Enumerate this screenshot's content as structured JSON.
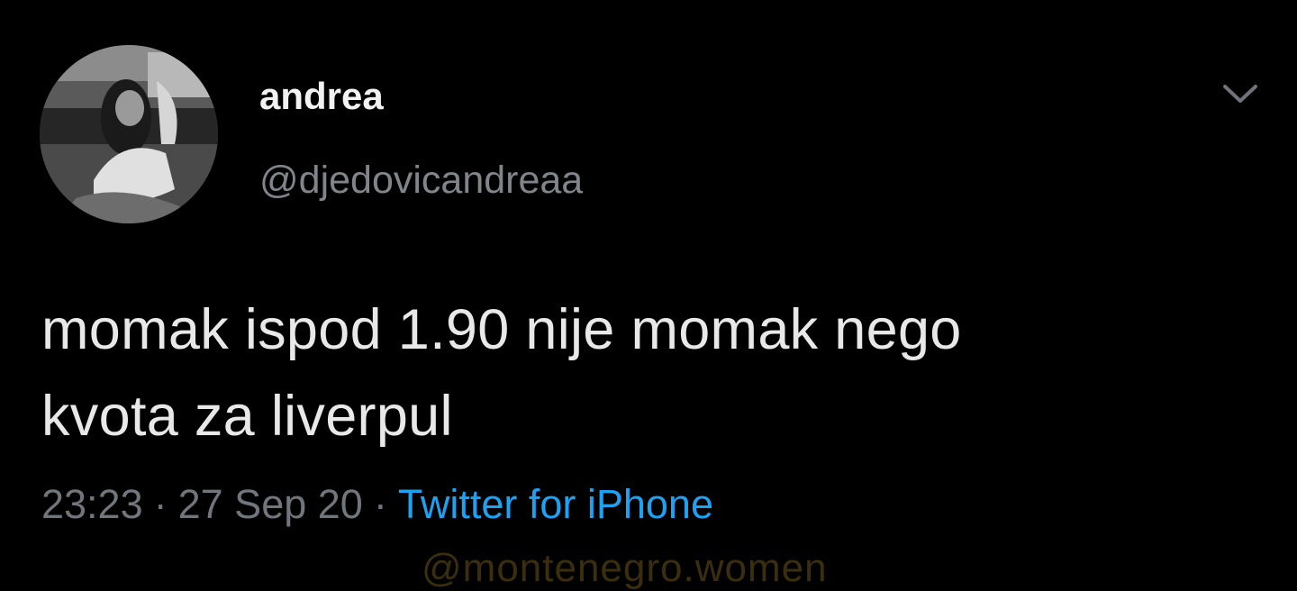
{
  "tweet": {
    "author": {
      "display_name": "andrea",
      "handle": "@djedovicandreaa",
      "avatar_icon": "profile-photo"
    },
    "menu_icon": "chevron-down-icon",
    "text_line1": "momak ispod 1.90 nije momak nego",
    "text_line2": "kvota za liverpul",
    "time": "23:23",
    "date": "27 Sep 20",
    "separator": "·",
    "source": "Twitter for iPhone"
  },
  "watermark": "@montenegro.women",
  "colors": {
    "background": "#000000",
    "text": "#e8e8e8",
    "secondary_text": "#70767c",
    "link": "#1da1f2"
  }
}
